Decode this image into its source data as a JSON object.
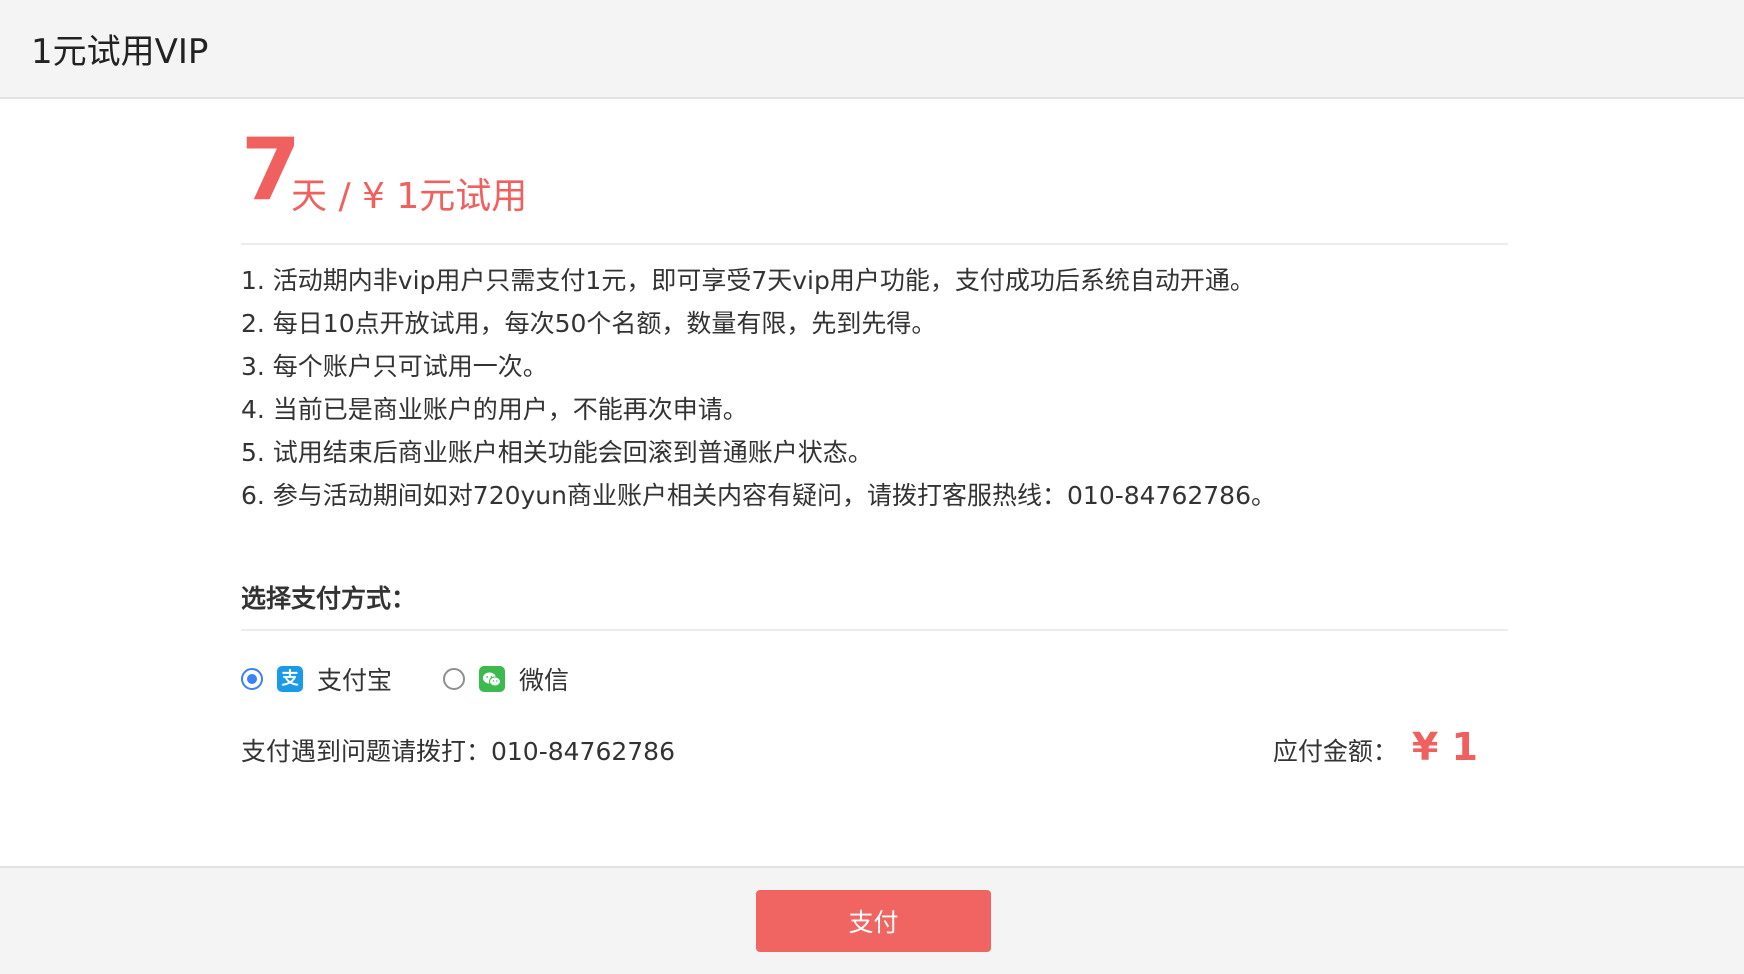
{
  "header": {
    "title": "1元试用VIP"
  },
  "offer": {
    "days": "7",
    "price_text": "天 / ¥ 1元试用"
  },
  "rules": [
    "1. 活动期内非vip用户只需支付1元，即可享受7天vip用户功能，支付成功后系统自动开通。",
    "2. 每日10点开放试用，每次50个名额，数量有限，先到先得。",
    "3. 每个账户只可试用一次。",
    "4. 当前已是商业账户的用户，不能再次申请。",
    "5. 试用结束后商业账户相关功能会回滚到普通账户状态。",
    "6. 参与活动期间如对720yun商业账户相关内容有疑问，请拨打客服热线：010-84762786。"
  ],
  "payment": {
    "section_label": "选择支付方式：",
    "methods": [
      {
        "label": "支付宝",
        "icon": "alipay-icon",
        "selected": true,
        "color": "#1a9be8"
      },
      {
        "label": "微信",
        "icon": "wechat-icon",
        "selected": false,
        "color": "#3dba4e"
      }
    ],
    "help_text": "支付遇到问题请拨打：010-84762786",
    "amount_label": "应付金额：",
    "amount_value": "¥ 1"
  },
  "footer": {
    "pay_button_label": "支付"
  },
  "colors": {
    "accent": "#f0605e",
    "button": "#f06462",
    "radio_selected": "#3b82f6"
  }
}
